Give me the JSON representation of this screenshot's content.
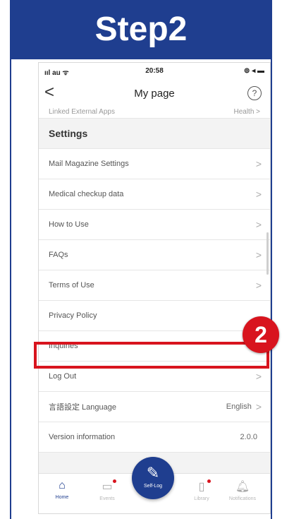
{
  "header": {
    "title": "Step2"
  },
  "statusbar": {
    "signal": "ııl au ᯤ",
    "time": "20:58",
    "battery": "⊚ ◂ ▬"
  },
  "navbar": {
    "back": "<",
    "title": "My page",
    "help": "?"
  },
  "partial_row": {
    "label": "Linked External Apps",
    "value": "Health >"
  },
  "settings": {
    "title": "Settings",
    "items": [
      {
        "label": "Mail Magazine Settings",
        "value": "",
        "chevron": ">"
      },
      {
        "label": "Medical checkup data",
        "value": "",
        "chevron": ">"
      },
      {
        "label": "How to Use",
        "value": "",
        "chevron": ">"
      },
      {
        "label": "FAQs",
        "value": "",
        "chevron": ">"
      },
      {
        "label": "Terms of Use",
        "value": "",
        "chevron": ">"
      },
      {
        "label": "Privacy Policy",
        "value": "",
        "chevron": ""
      },
      {
        "label": "Inquiries",
        "value": "",
        "chevron": ""
      },
      {
        "label": "Log Out",
        "value": "",
        "chevron": ">"
      },
      {
        "label": "言語設定 Language",
        "value": "English",
        "chevron": ">"
      },
      {
        "label": "Version information",
        "value": "2.0.0",
        "chevron": ""
      }
    ]
  },
  "callout": {
    "number": "2"
  },
  "tabbar": {
    "home": "Home",
    "events": "Events",
    "center": "Self-Log",
    "library": "Library",
    "notifications": "Notifications"
  },
  "colors": {
    "brand": "#1f3e8f",
    "highlight": "#d8141e"
  }
}
